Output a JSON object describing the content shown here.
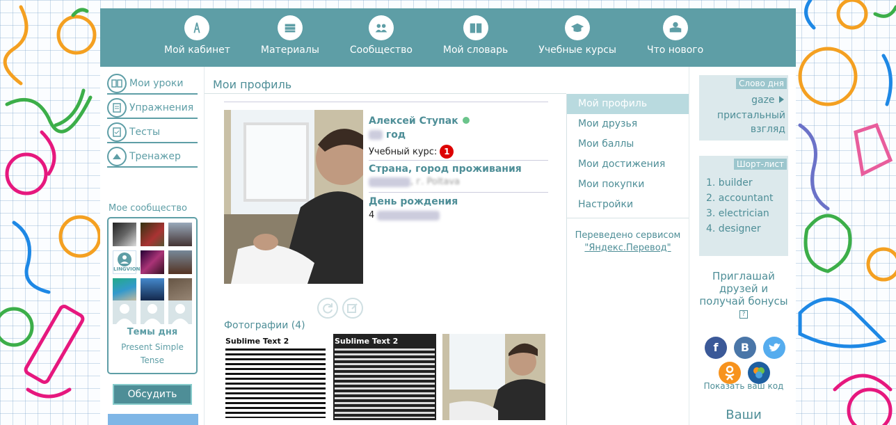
{
  "nav": [
    {
      "label": "Мой кабинет",
      "icon": "dashboard-icon"
    },
    {
      "label": "Материалы",
      "icon": "materials-icon"
    },
    {
      "label": "Сообщество",
      "icon": "community-icon"
    },
    {
      "label": "Мой словарь",
      "icon": "dictionary-icon"
    },
    {
      "label": "Учебные курсы",
      "icon": "courses-icon"
    },
    {
      "label": "Что нового",
      "icon": "news-icon"
    }
  ],
  "sidebar": {
    "items": [
      {
        "label": "Мои уроки",
        "icon": "lessons-icon"
      },
      {
        "label": "Упражнения",
        "icon": "exercises-icon"
      },
      {
        "label": "Тесты",
        "icon": "tests-icon"
      },
      {
        "label": "Тренажер",
        "icon": "trainer-icon"
      }
    ],
    "community_title": "Мое сообщество",
    "lingvion_label": "LINGVION",
    "topics_title": "Темы дня",
    "topics_text": "Present Simple Tense",
    "discuss_button": "Обсудить"
  },
  "main": {
    "title": "Мои профиль",
    "name": "Алексей Ступак",
    "age_suffix": "год",
    "course_label": "Учебный курс:",
    "course_badge": "1",
    "location_label": "Страна, город проживания",
    "location_value": ", г. Poltava",
    "birthday_label": "День рождения",
    "birthday_value": "4",
    "photos_label": "Фотографии (4)",
    "thumb_text": "Sublime Text 2"
  },
  "profile_menu": {
    "items": [
      "Мой профиль",
      "Мои друзья",
      "Мои баллы",
      "Мои достижения",
      "Мои покупки",
      "Настройки"
    ],
    "translated_text": "Переведено сервисом",
    "translated_link": "\"Яндекс.Перевод\""
  },
  "right": {
    "word_tag": "Слово дня",
    "word_en": "gaze",
    "word_ru": "пристальный взгляд",
    "short_tag": "Шорт-лист",
    "short_list": [
      "1. builder",
      "2. accountant",
      "3. electrician",
      "4. designer"
    ],
    "invite_text": "Приглашай друзей и получай бонусы",
    "help_mark": "?",
    "social": [
      {
        "label": "f",
        "color": "#3b5998",
        "icon": "facebook-icon"
      },
      {
        "label": "B",
        "color": "#4a76a8",
        "icon": "vk-icon"
      },
      {
        "label": "",
        "color": "#55acee",
        "icon": "twitter-icon"
      },
      {
        "label": "",
        "color": "#f7931e",
        "icon": "odnoklassniki-icon"
      },
      {
        "label": "",
        "color": "#1e5fa0",
        "icon": "mailru-icon"
      }
    ],
    "show_code": "Показать ваш код",
    "yours": "Ваши"
  },
  "colors": {
    "accent": "#5e9ea6",
    "accent_dark": "#4e8e97",
    "badge": "#dd0000",
    "online": "#6bc48b"
  }
}
